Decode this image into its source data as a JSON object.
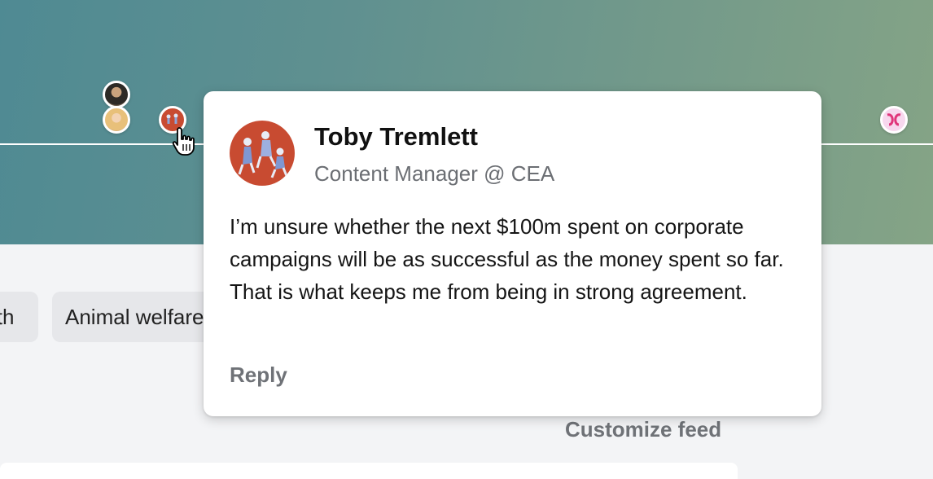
{
  "feed": {
    "chips": [
      "lth",
      "Animal welfare"
    ],
    "customize_label": "Customize feed"
  },
  "popover": {
    "name": "Toby Tremlett",
    "role": "Content Manager @ CEA",
    "body": "I’m unsure whether the next $100m spent on corporate campaigns will be as successful as the money spent so far. That is what keeps me from being in strong agreement.",
    "reply_label": "Reply"
  },
  "colors": {
    "banner_start": "#4f8a93",
    "banner_end": "#85a486",
    "avatar_red": "#c84b31"
  }
}
